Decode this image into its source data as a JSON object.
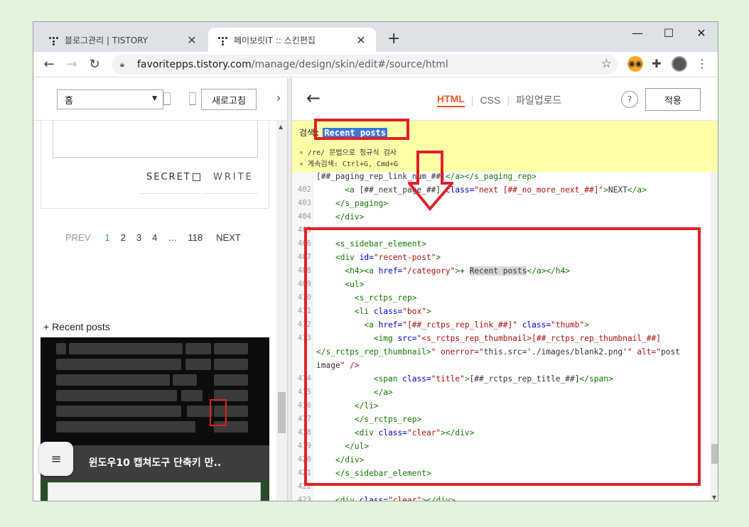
{
  "browser": {
    "tabs": [
      {
        "title": "블로그관리 | TISTORY",
        "close": "✕"
      },
      {
        "title": "페이보릿IT :: 스킨편집",
        "close": "✕"
      }
    ],
    "new_tab": "+",
    "window_controls": {
      "minimize": "—",
      "maximize": "☐",
      "close": "✕"
    },
    "url_host": "favoritepps.tistory.com",
    "url_path": "/manage/design/skin/edit#/source/html",
    "icons": [
      "back-icon",
      "forward-icon",
      "reload-icon",
      "lock-icon",
      "star-icon",
      "owl-extension-icon",
      "puzzle-icon",
      "avatar-icon",
      "kebab-menu-icon"
    ]
  },
  "preview": {
    "page_select": "홈",
    "refresh_label": "새로고침",
    "secret_label": "SECRET",
    "write_label": "WRITE",
    "pager": {
      "prev": "PREV",
      "pages": [
        "1",
        "2",
        "3",
        "4",
        "…",
        "118"
      ],
      "current": "1",
      "next": "NEXT"
    },
    "recent_heading": "+ Recent posts",
    "post_title": "윈도우10 캡쳐도구 단축키 만..",
    "menu_icon": "≡"
  },
  "editor": {
    "tabs": {
      "html": "HTML",
      "css": "CSS",
      "upload": "파일업로드"
    },
    "help": "?",
    "apply": "적용",
    "search": {
      "label": "검색:",
      "query": "Recent posts",
      "hint_regex": "/re/ 문법으로 정규식 검사",
      "hint_next": "계속검색: Ctrl+G, Cmd+G"
    },
    "colors": {
      "tag": "#117700",
      "attr": "#0000cc",
      "string": "#aa1111",
      "accent": "#e8582b",
      "annotation": "#e0202a"
    },
    "lines": [
      {
        "n": "",
        "code": "[##_paging_rep_link_num_##]</a></s_paging_rep>"
      },
      {
        "n": "402",
        "code": "      <a [##_next_page_##] class=\"next [##_no_more_next_##]\">NEXT</a>"
      },
      {
        "n": "403",
        "code": "    </s_paging>"
      },
      {
        "n": "404",
        "code": "    </div>"
      },
      {
        "n": "405",
        "code": ""
      },
      {
        "n": "406",
        "code": "    <s_sidebar_element>"
      },
      {
        "n": "407",
        "code": "    <div id=\"recent-post\">"
      },
      {
        "n": "408",
        "code": "      <h4><a href=\"/category\">+ Recent posts</a></h4>"
      },
      {
        "n": "409",
        "code": "      <ul>"
      },
      {
        "n": "410",
        "code": "        <s_rctps_rep>"
      },
      {
        "n": "411",
        "code": "        <li class=\"box\">"
      },
      {
        "n": "412",
        "code": "          <a href=\"[##_rctps_rep_link_##]\" class=\"thumb\">"
      },
      {
        "n": "413",
        "code": "            <img src=\"<s_rctps_rep_thumbnail>[##_rctps_rep_thumbnail_##]"
      },
      {
        "n": "",
        "code": "</s_rctps_rep_thumbnail>\" onerror=\"this.src='./images/blank2.png'\" alt=\"post"
      },
      {
        "n": "",
        "code": "image\" />"
      },
      {
        "n": "414",
        "code": "            <span class=\"title\">[##_rctps_rep_title_##]</span>"
      },
      {
        "n": "415",
        "code": "            </a>"
      },
      {
        "n": "416",
        "code": "        </li>"
      },
      {
        "n": "417",
        "code": "        </s_rctps_rep>"
      },
      {
        "n": "418",
        "code": "        <div class=\"clear\"></div>"
      },
      {
        "n": "419",
        "code": "      </ul>"
      },
      {
        "n": "420",
        "code": "    </div>"
      },
      {
        "n": "421",
        "code": "    </s_sidebar_element>"
      },
      {
        "n": "422",
        "code": ""
      },
      {
        "n": "423",
        "code": "    <div class=\"clear\"></div>"
      }
    ]
  }
}
